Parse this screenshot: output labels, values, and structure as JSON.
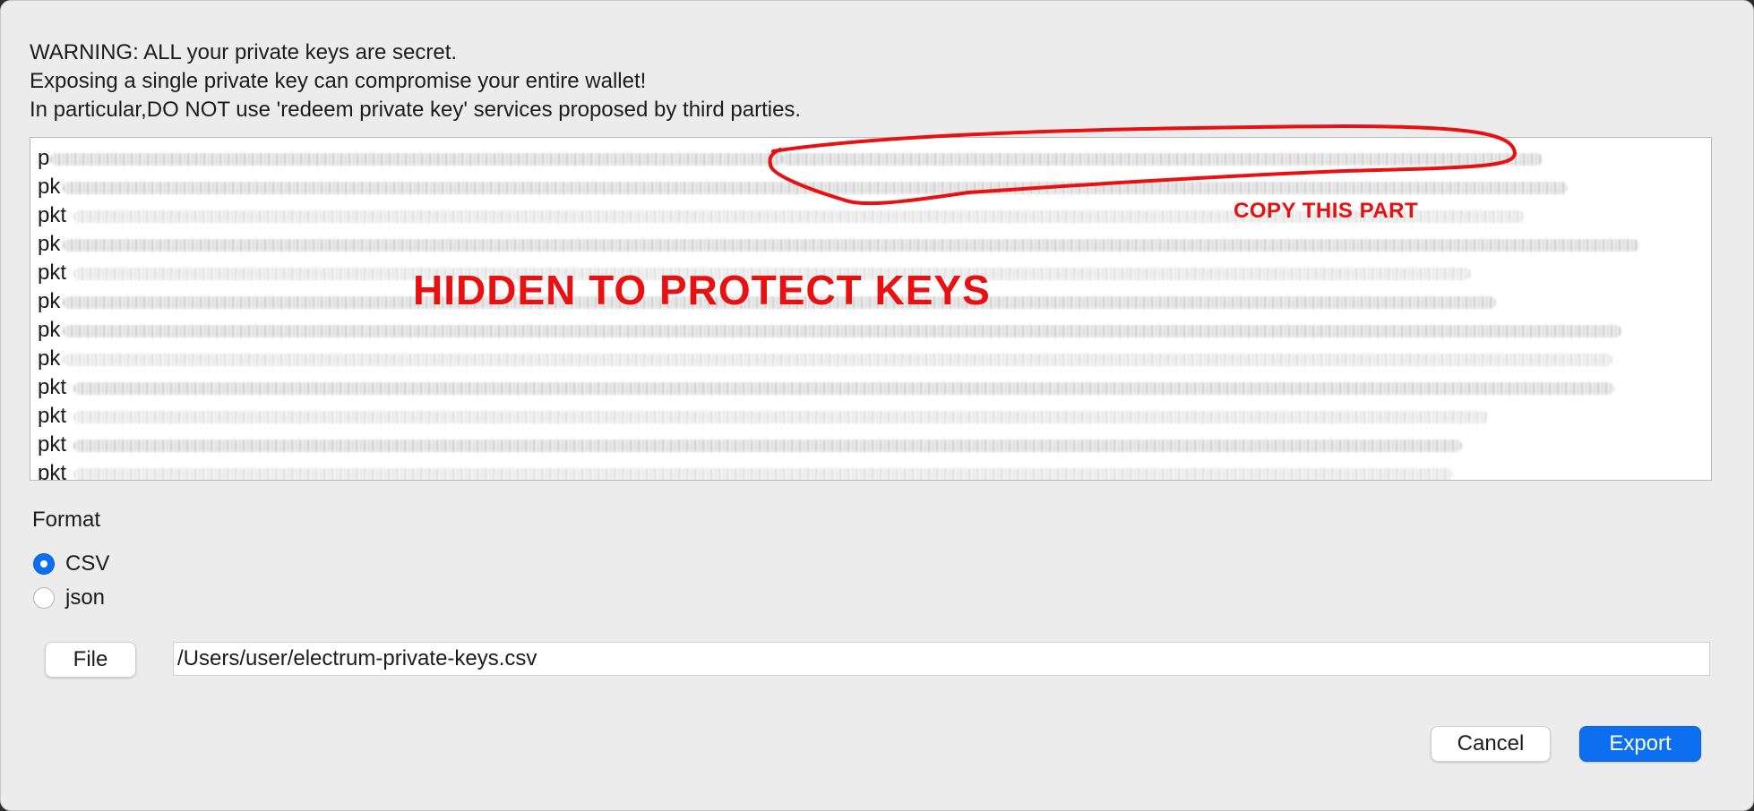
{
  "warning": {
    "line1": "WARNING: ALL your private keys are secret.",
    "line2": "Exposing a single private key can compromise your entire wallet!",
    "line3": "In particular,DO NOT use 'redeem private key' services proposed by third parties."
  },
  "keys": {
    "lines": [
      "p",
      "pk",
      "pkt",
      "pk",
      "pkt",
      "pk",
      "pk",
      "pk",
      "pkt",
      "pkt",
      "pkt",
      "pkt"
    ],
    "hidden_label": "HIDDEN TO PROTECT KEYS",
    "copy_label": "COPY THIS PART"
  },
  "format": {
    "label": "Format",
    "options": [
      {
        "label": "CSV",
        "selected": true
      },
      {
        "label": "json",
        "selected": false
      }
    ]
  },
  "file": {
    "button_label": "File",
    "path": "/Users/user/electrum-private-keys.csv"
  },
  "actions": {
    "cancel_label": "Cancel",
    "export_label": "Export"
  },
  "colors": {
    "accent": "#0b6ff0",
    "annotation": "#e81010"
  }
}
